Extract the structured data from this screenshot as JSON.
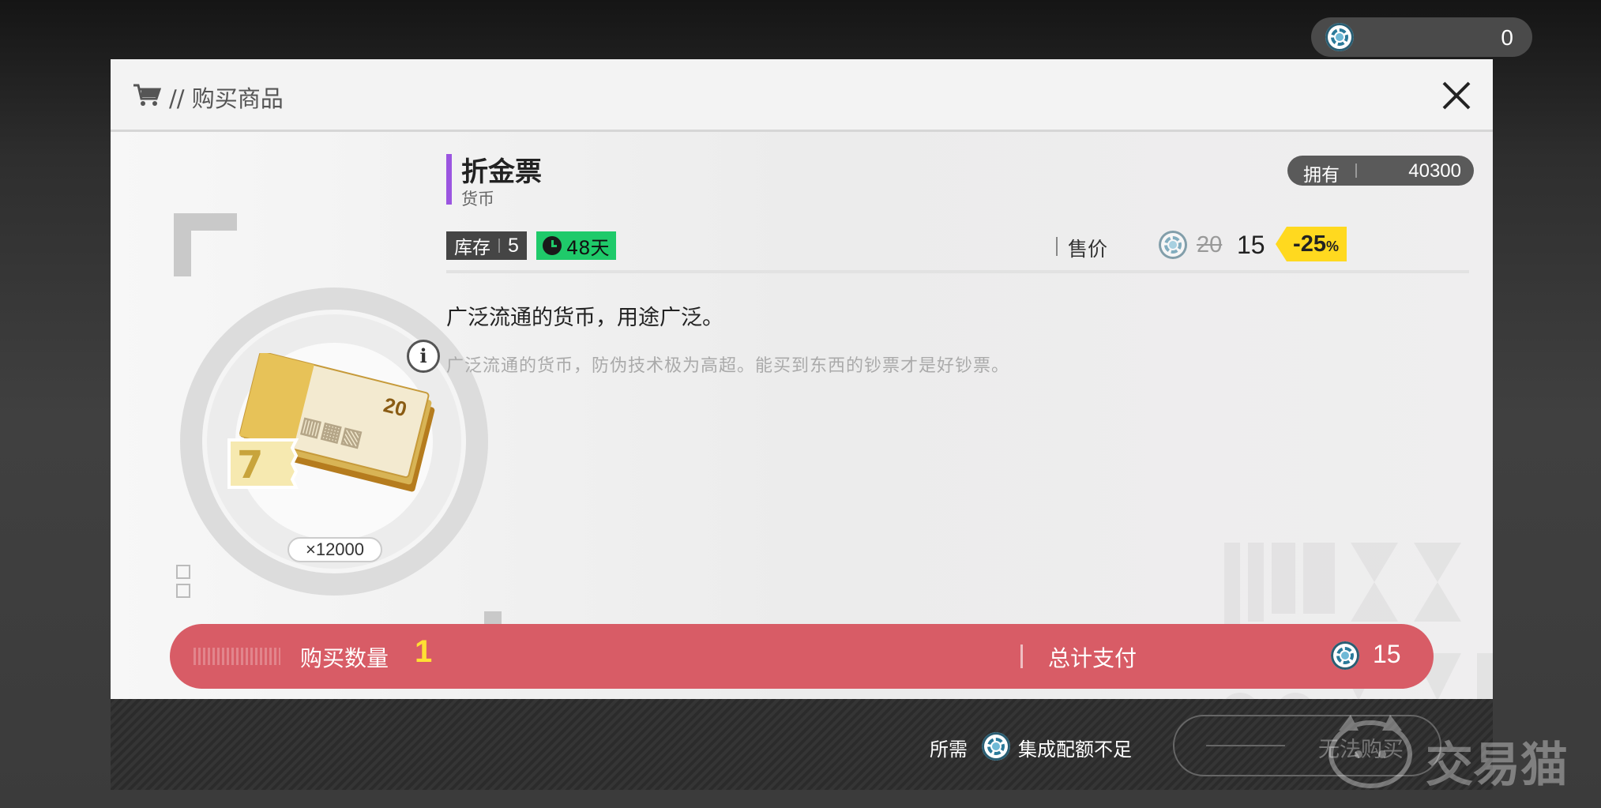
{
  "top_bar": {
    "currency_icon": "coin-icon",
    "balance": "0"
  },
  "dialog": {
    "title_icon": "cart-icon",
    "title": "// 购买商品",
    "close_icon": "close-icon"
  },
  "item": {
    "name": "折金票",
    "type": "货币",
    "quantity_badge": "×12000",
    "info_icon": "info-icon",
    "owned_label": "拥有",
    "owned_value": "40300",
    "stock_label": "库存",
    "stock_value": "5",
    "time_left": "48天",
    "price_label": "售价",
    "old_price": "20",
    "new_price": "15",
    "discount": "-25",
    "discount_unit": "%",
    "description": "广泛流通的货币，用途广泛。",
    "lore": "广泛流通的货币，防伪技术极为高超。能买到东西的钞票才是好钞票。"
  },
  "purchase": {
    "quantity_label": "购买数量",
    "quantity_value": "1",
    "total_label": "总计支付",
    "total_value": "15"
  },
  "footer": {
    "required_label": "所需",
    "insufficient_message": "集成配额不足",
    "buy_button": "无法购买"
  },
  "watermark": "交易猫",
  "colors": {
    "accent_purple": "#9b55e0",
    "purchase_bar": "#d85c66",
    "time_green": "#1fca6a",
    "discount_yellow": "#ffd91f",
    "quantity_yellow": "#ffe033"
  }
}
